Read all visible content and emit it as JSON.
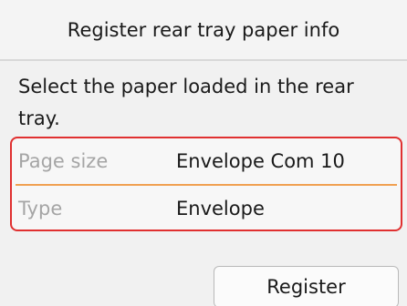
{
  "header": {
    "title": "Register rear tray paper info"
  },
  "instruction": {
    "text": "Select the paper loaded in the rear tray."
  },
  "settings": {
    "page_size": {
      "label": "Page size",
      "value": "Envelope Com 10"
    },
    "type": {
      "label": "Type",
      "value": "Envelope"
    }
  },
  "actions": {
    "register_label": "Register"
  },
  "colors": {
    "highlight_border": "#e03030",
    "row_divider": "#f0a052",
    "label_text": "#a5a5a5"
  }
}
